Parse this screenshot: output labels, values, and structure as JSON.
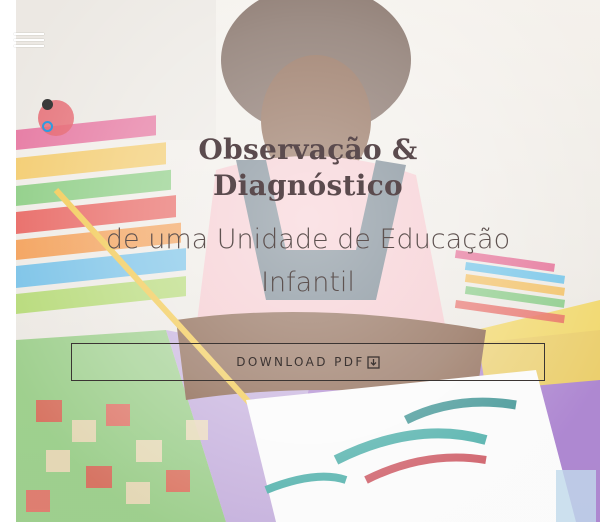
{
  "menu": {
    "icon": "hamburger-icon"
  },
  "slider": {
    "dots": [
      "active",
      "inactive"
    ]
  },
  "hero": {
    "title": "Observação & Diagnóstico",
    "subtitle": "de uma Unidade de Educação Infantil",
    "button_label": "DOWNLOAD PDF",
    "button_icon": "download-icon"
  },
  "colors": {
    "title": "#5b4b4e",
    "subtitle": "#5e5250",
    "button_border": "#3b3533",
    "dot_active": "#3a3a3a",
    "dot_inactive": "#2f9be0"
  }
}
